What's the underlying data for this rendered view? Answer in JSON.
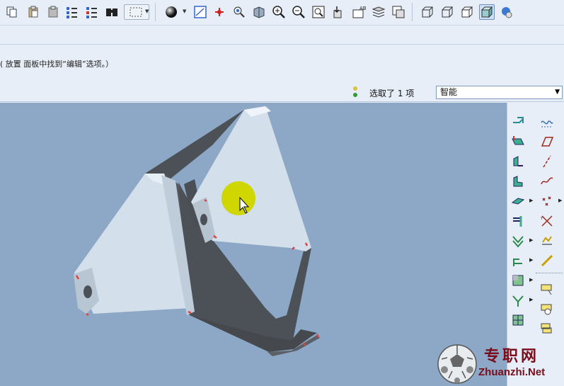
{
  "toolbar": {
    "groups": [
      {
        "items": [
          "copy-icon",
          "paste-icon",
          "paste-special-icon",
          "regenerate-icon",
          "regen-manager-icon",
          "find-icon",
          "select-box-icon"
        ]
      },
      {
        "items": [
          "shading-sphere-icon",
          "sketch-view-icon",
          "datum-axis-icon",
          "spin-center-icon",
          "orient-icon",
          "zoom-in-icon",
          "zoom-out-icon",
          "refit-icon",
          "reorient-icon",
          "named-views-icon",
          "layers-icon",
          "view-manager-icon"
        ]
      },
      {
        "items": [
          "wireframe-icon",
          "hidden-line-icon",
          "no-hidden-icon",
          "shaded-icon",
          "appearance-icon"
        ]
      }
    ]
  },
  "message": {
    "text": "( 放置 面板中找到“编辑”选项。）"
  },
  "status": {
    "selected_text": "选取了 1 项",
    "filter_value": "智能",
    "traffic_colors": {
      "top": "#d9c23a",
      "bottom": "#2ea02e"
    }
  },
  "viewport": {
    "background": "#8ca8c6",
    "cursor_highlight_color": "#cfd600"
  },
  "right_toolbar": {
    "left_column": [
      "sheetmetal-wall-icon",
      "flat-wall-icon",
      "flange-wall-icon",
      "twist-wall-icon",
      "extend-wall-icon",
      "merge-wall-icon",
      "bend-icon",
      "edge-bend-icon",
      "unbend-icon",
      "bend-back-icon",
      "flat-pattern-icon"
    ],
    "right_column": [
      "datum-curve-sketch-icon",
      "datum-plane-icon",
      "datum-axis-tool-icon",
      "datum-curve-icon",
      "datum-point-icon",
      "coordinate-system-icon",
      "analysis-icon",
      "insert-analysis-icon",
      "annotation-icon",
      "insert-ui-icon",
      "form-icon"
    ]
  },
  "watermark": {
    "title": "专职网",
    "url": "Zhuanzhi.Net"
  }
}
